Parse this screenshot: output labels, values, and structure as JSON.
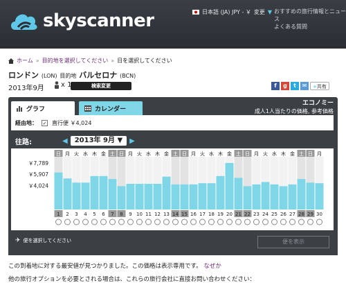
{
  "header": {
    "brand": "skyscanner",
    "language_label": "日本語 (JA)  JPY - ￥",
    "change_label": "変更",
    "top_links": [
      "おすすめの旅行情報とニュース",
      "よくある質問"
    ]
  },
  "breadcrumb": {
    "items": [
      "ホーム",
      "目的地を選択してください",
      "日を選択してください"
    ]
  },
  "route": {
    "origin": "ロンドン",
    "origin_code": "(LON)",
    "dest_prefix": "目的地",
    "destination": "バルセロナ",
    "dest_code": "(BCN)"
  },
  "search": {
    "month": "2013年9月",
    "passengers": "x 1",
    "change_search_label": "検索変更",
    "share_label": "共有"
  },
  "panel": {
    "tab_graph": "グラフ",
    "tab_calendar": "カレンダー",
    "cabin_class": "エコノミー",
    "price_note": "成人1人当たりの価格, 参考価格",
    "route_label": "経由地：",
    "direct_label": "直行便 ￥4,024",
    "outbound_label": "往路:",
    "month_select": "2013年 9月",
    "return_label": "便を選択してください",
    "show_flights_label": "便を表示"
  },
  "chart_data": {
    "type": "bar",
    "y_ticks": [
      "￥7,789",
      "￥5,907",
      "￥4,024"
    ],
    "ylim": [
      0,
      8600
    ],
    "days": [
      1,
      2,
      3,
      4,
      5,
      6,
      7,
      8,
      9,
      10,
      11,
      12,
      13,
      14,
      15,
      16,
      17,
      18,
      19,
      20,
      21,
      22,
      23,
      24,
      25,
      26,
      27,
      28,
      29,
      30
    ],
    "weekdays": [
      "日",
      "月",
      "火",
      "水",
      "木",
      "金",
      "土",
      "日",
      "月",
      "火",
      "水",
      "木",
      "金",
      "土",
      "日",
      "月",
      "火",
      "水",
      "木",
      "金",
      "土",
      "日",
      "月",
      "火",
      "水",
      "木",
      "金",
      "土",
      "日",
      "月"
    ],
    "values": [
      6200,
      5200,
      4500,
      4500,
      5600,
      5600,
      5100,
      3900,
      4300,
      4300,
      4300,
      4300,
      5500,
      4200,
      4200,
      4200,
      4400,
      4400,
      5600,
      7789,
      5300,
      3900,
      4200,
      4600,
      4200,
      3900,
      4200,
      5100,
      4500,
      4400
    ],
    "weekend_days": [
      1,
      7,
      8,
      14,
      15,
      21,
      22,
      28,
      29
    ],
    "highlighted_days": [
      1,
      7,
      8,
      14,
      15,
      21,
      22,
      28,
      29
    ]
  },
  "message": {
    "text": "この到着地に対する最安値が見つかりました。この価格は表示専用です。",
    "link": "なぜか",
    "text2": "他の旅行オプションを必要とされる場合は、これらの旅行会社に直接お問い合わせください："
  },
  "colors": {
    "accent": "#7fd6e6",
    "header_bg": "#2a2e33",
    "panel_bg": "#3b4045",
    "link": "#6b2c74"
  }
}
